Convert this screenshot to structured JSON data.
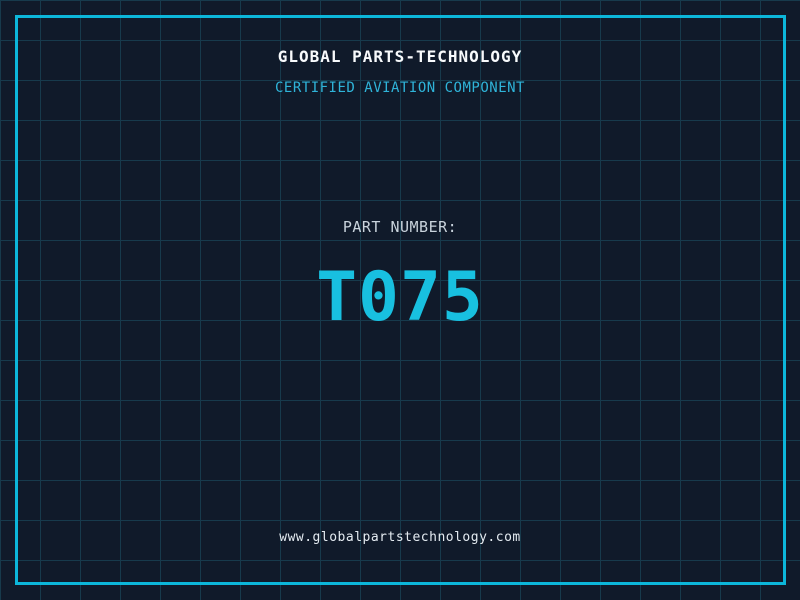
{
  "colors": {
    "background": "#101a2a",
    "grid_line": "#173a4c",
    "frame": "#0cb6da",
    "title": "#f8fafc",
    "subtitle": "#2fb4d9",
    "label": "#c9d3dc",
    "part_number": "#18c0e0",
    "footer_text": "#e4ebf1"
  },
  "header": {
    "title": "GLOBAL PARTS-TECHNOLOGY",
    "subtitle": "CERTIFIED AVIATION COMPONENT"
  },
  "part": {
    "label": "PART NUMBER:",
    "number": "T075"
  },
  "footer": {
    "url": "www.globalpartstechnology.com"
  }
}
